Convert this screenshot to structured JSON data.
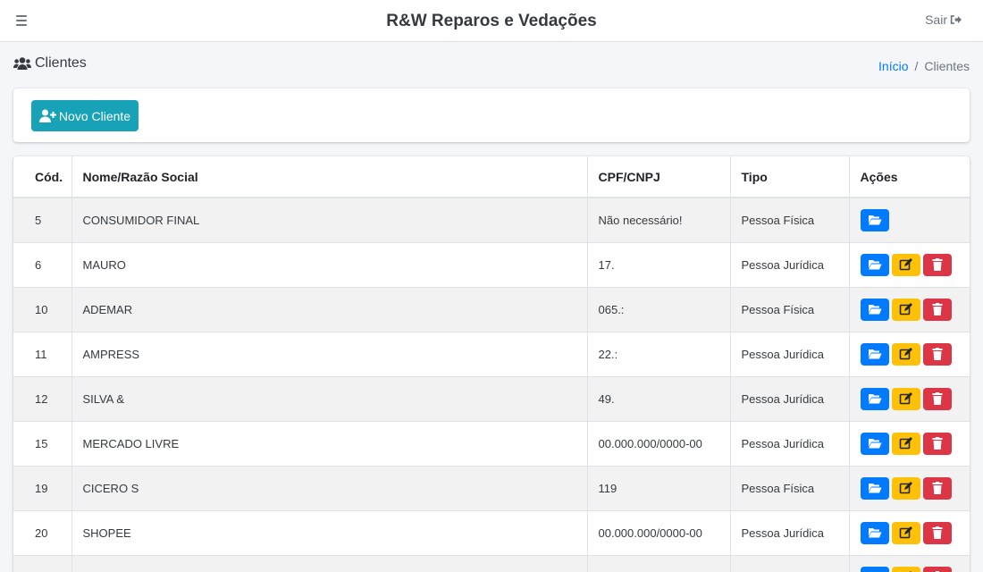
{
  "header": {
    "title": "R&W Reparos e Vedações",
    "logout_label": "Sair"
  },
  "page": {
    "title": "Clientes",
    "breadcrumb": {
      "home": "Início",
      "current": "Clientes"
    }
  },
  "actions": {
    "new_client_label": "Novo Cliente"
  },
  "table": {
    "headers": {
      "code": "Cód.",
      "name": "Nome/Razão Social",
      "doc": "CPF/CNPJ",
      "type": "Tipo",
      "actions": "Ações"
    },
    "rows": [
      {
        "code": "5",
        "name": "CONSUMIDOR FINAL",
        "doc": "Não necessário!",
        "type": "Pessoa Física",
        "view_only": true
      },
      {
        "code": "6",
        "name": "MAURO",
        "doc": "17.",
        "type": "Pessoa Jurídica"
      },
      {
        "code": "10",
        "name": "ADEMAR",
        "doc": "065.:",
        "type": "Pessoa Física"
      },
      {
        "code": "11",
        "name": "AMPRESS",
        "doc": "22.:",
        "type": "Pessoa Jurídica"
      },
      {
        "code": "12",
        "name": "SILVA &",
        "doc": "49.",
        "type": "Pessoa Jurídica"
      },
      {
        "code": "15",
        "name": "MERCADO LIVRE",
        "doc": "00.000.000/0000-00",
        "type": "Pessoa Jurídica"
      },
      {
        "code": "19",
        "name": "CICERO S",
        "doc": "119",
        "type": "Pessoa Física"
      },
      {
        "code": "20",
        "name": "SHOPEE",
        "doc": "00.000.000/0000-00",
        "type": "Pessoa Jurídica"
      },
      {
        "code": "",
        "name": "",
        "doc": "",
        "type": ""
      }
    ]
  },
  "colors": {
    "info": "#17a2b8",
    "primary": "#007bff",
    "warning": "#ffc107",
    "danger": "#dc3545"
  }
}
